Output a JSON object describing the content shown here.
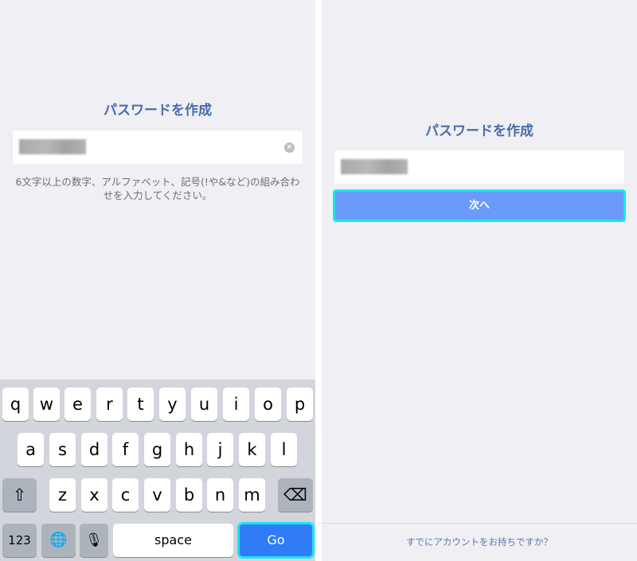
{
  "left": {
    "title": "パスワードを作成",
    "clear_icon": "×",
    "hint": "6文字以上の数字、アルファベット、記号(!や&など)の組み合わせを入力してください。"
  },
  "keyboard": {
    "row1": [
      "q",
      "w",
      "e",
      "r",
      "t",
      "y",
      "u",
      "i",
      "o",
      "p"
    ],
    "row2": [
      "a",
      "s",
      "d",
      "f",
      "g",
      "h",
      "j",
      "k",
      "l"
    ],
    "row3": [
      "z",
      "x",
      "c",
      "v",
      "b",
      "n",
      "m"
    ],
    "shift_icon": "⇧",
    "delete_icon": "⌫",
    "numbers_label": "123",
    "globe_icon": "🌐",
    "mic_icon": "🎙",
    "space_label": "space",
    "go_label": "Go"
  },
  "right": {
    "title": "パスワードを作成",
    "next_label": "次へ",
    "footer_link": "すでにアカウントをお持ちですか？"
  }
}
